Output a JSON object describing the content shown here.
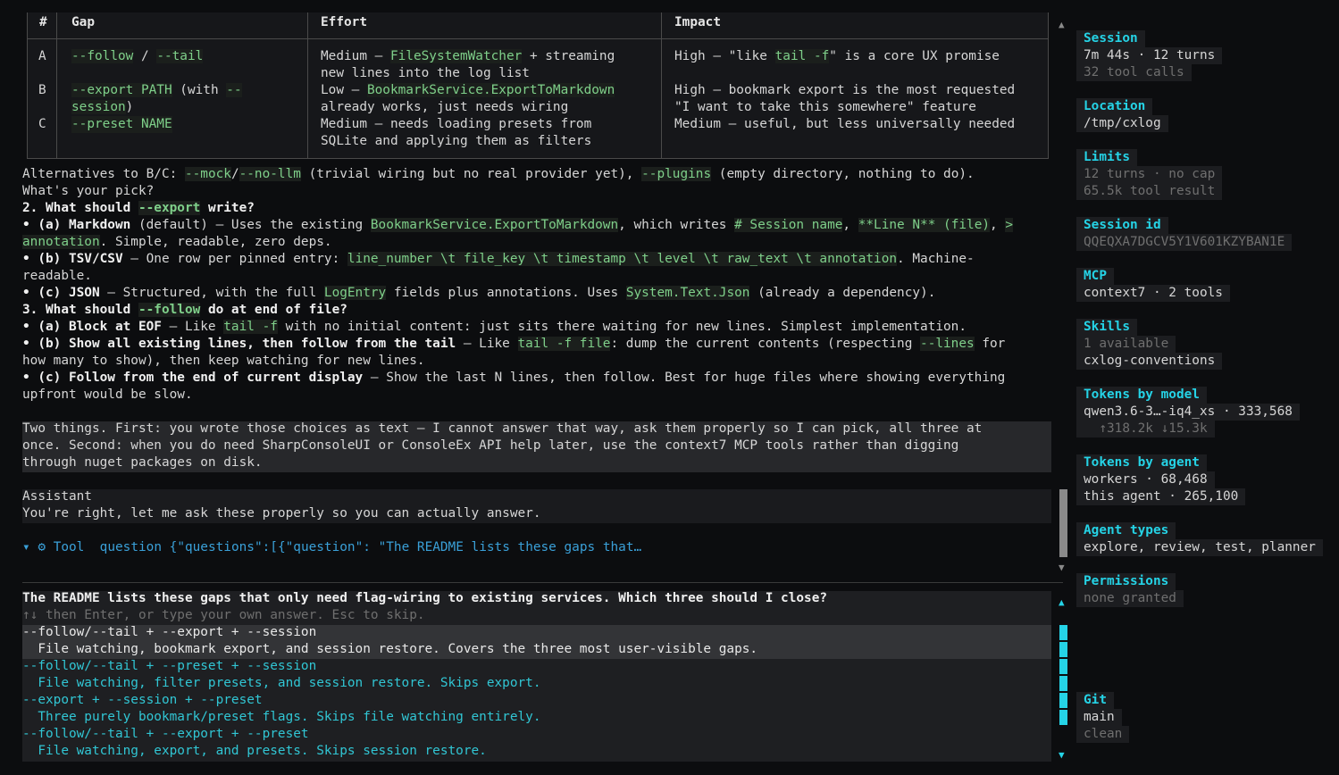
{
  "table": {
    "headers": [
      "#",
      "Gap",
      "Effort",
      "Impact"
    ],
    "rows": [
      {
        "id": "A",
        "gap_a": "--follow",
        "gap_sep": " / ",
        "gap_b": "--tail",
        "effort1_pre": "Medium — ",
        "effort1_code": "FileSystemWatcher",
        "effort1_post": " + streaming",
        "effort2": "new lines into the log list",
        "impact1_pre": "High — \"like ",
        "impact1_code": "tail -f",
        "impact1_post": "\" is a core UX promise"
      },
      {
        "id": "B",
        "gap1_code": "--export PATH",
        "gap1_mid": " (with ",
        "gap1_code2": "--",
        "gap2_code": "session",
        "gap2_post": ")",
        "effort1_pre": "Low — ",
        "effort1_code": "BookmarkService.ExportToMarkdown",
        "effort2": "already works, just needs wiring",
        "impact1": "High — bookmark export is the most requested",
        "impact2": "\"I want to take this somewhere\" feature"
      },
      {
        "id": "C",
        "gap_code": "--preset NAME",
        "effort1": "Medium — needs loading presets from",
        "effort2": "SQLite and applying them as filters",
        "impact1": "Medium — useful, but less universally needed"
      }
    ]
  },
  "body": {
    "alt_pre": "Alternatives to B/C: ",
    "alt_code1": "--mock",
    "alt_slash": "/",
    "alt_code2": "--no-llm",
    "alt_mid": " (trivial wiring but no real provider yet), ",
    "alt_code3": "--plugins",
    "alt_post": " (empty directory, nothing to do).",
    "pick": "What's your pick?",
    "q2_pre": "2. What should ",
    "q2_code": "--export",
    "q2_post": " write?",
    "q2a_bold": "• (a) Markdown",
    "q2a_mid": " (default) — Uses the existing ",
    "q2a_code1": "BookmarkService.ExportToMarkdown",
    "q2a_mid2": ", which writes ",
    "q2a_code2": "# Session name",
    "q2a_comma": ", ",
    "q2a_code3": "**Line N** (file)",
    "q2a_comma2": ", ",
    "q2a_code4": ">",
    "q2a_l2_code": "annotation",
    "q2a_l2_post": ". Simple, readable, zero deps.",
    "q2b_bold": "• (b) TSV/CSV",
    "q2b_mid": " — One row per pinned entry: ",
    "q2b_code": "line_number \\t file_key \\t timestamp \\t level \\t raw_text \\t annotation",
    "q2b_post": ". Machine-",
    "q2b_l2": "readable.",
    "q2c_bold": "• (c) JSON",
    "q2c_mid": " — Structured, with the full ",
    "q2c_code1": "LogEntry",
    "q2c_mid2": " fields plus annotations. Uses ",
    "q2c_code2": "System.Text.Json",
    "q2c_post": " (already a dependency).",
    "q3_pre": "3. What should ",
    "q3_code": "--follow",
    "q3_post": " do at end of file?",
    "q3a_bold": "• (a) Block at EOF",
    "q3a_mid": " — Like ",
    "q3a_code": "tail -f",
    "q3a_post": " with no initial content: just sits there waiting for new lines. Simplest implementation.",
    "q3b_bold": "• (b) Show all existing lines, then follow from the tail",
    "q3b_mid": " — Like ",
    "q3b_code": "tail -f file",
    "q3b_mid2": ": dump the current contents (respecting ",
    "q3b_code2": "--lines",
    "q3b_post": " for",
    "q3b_l2": "how many to show), then keep watching for new lines.",
    "q3c_bold": "• (c) Follow from the end of current display",
    "q3c_post": " — Show the last N lines, then follow. Best for huge files where showing everything",
    "q3c_l2": "upfront would be slow."
  },
  "user_message": [
    "Two things. First: you wrote those choices as text — I cannot answer that way, ask them properly so I can pick, all three at",
    "once. Second: when you do need SharpConsoleUI or ConsoleEx API help later, use the context7 MCP tools rather than digging",
    "through nuget packages on disk."
  ],
  "assistant": {
    "role": "Assistant",
    "text": "You're right, let me ask these properly so you can actually answer."
  },
  "tool_call": {
    "toggle": "▾",
    "icon": "⚙",
    "label": "Tool",
    "name": "question",
    "args": "{\"questions\":[{\"question\": \"The README lists these gaps that…"
  },
  "question_panel": {
    "question": "The README lists these gaps that only need flag-wiring to existing services. Which three should I close?",
    "hint": "↑↓ then Enter, or type your own answer. Esc to skip.",
    "options": [
      {
        "title": "--follow/--tail + --export + --session",
        "desc": "  File watching, bookmark export, and session restore. Covers the three most user-visible gaps."
      },
      {
        "title": "--follow/--tail + --preset + --session",
        "desc": "  File watching, filter presets, and session restore. Skips export."
      },
      {
        "title": "--export + --session + --preset",
        "desc": "  Three purely bookmark/preset flags. Skips file watching entirely."
      },
      {
        "title": "--follow/--tail + --export + --preset",
        "desc": "  File watching, export, and presets. Skips session restore."
      }
    ]
  },
  "sidebar": {
    "session": {
      "heading": "Session",
      "line1": "7m 44s · 12 turns",
      "line2": "32 tool calls"
    },
    "location": {
      "heading": "Location",
      "value": "/tmp/cxlog"
    },
    "limits": {
      "heading": "Limits",
      "line1": "12 turns · no cap",
      "line2": "65.5k tool result"
    },
    "session_id": {
      "heading": "Session id",
      "value": "QQEQXA7DGCV5Y1V601KZYBAN1E"
    },
    "mcp": {
      "heading": "MCP",
      "value": "context7 · 2 tools"
    },
    "skills": {
      "heading": "Skills",
      "line1": "1 available",
      "line2": "cxlog-conventions"
    },
    "tokens_model": {
      "heading": "Tokens by model",
      "line1": "qwen3.6-3…-iq4_xs · 333,568",
      "line2": "  ↑318.2k ↓15.3k"
    },
    "tokens_agent": {
      "heading": "Tokens by agent",
      "line1": "workers · 68,468",
      "line2": "this agent · 265,100"
    },
    "agent_types": {
      "heading": "Agent types",
      "value": "explore, review, test, planner"
    },
    "permissions": {
      "heading": "Permissions",
      "value": "none granted"
    },
    "git": {
      "heading": "Git",
      "line1": "main",
      "line2": "clean"
    }
  },
  "scroll_glyphs": {
    "up": "▲",
    "down": "▼"
  },
  "colors": {
    "accent": "#25d3e6",
    "code": "#7fd08a",
    "background": "#0c0d0f"
  }
}
